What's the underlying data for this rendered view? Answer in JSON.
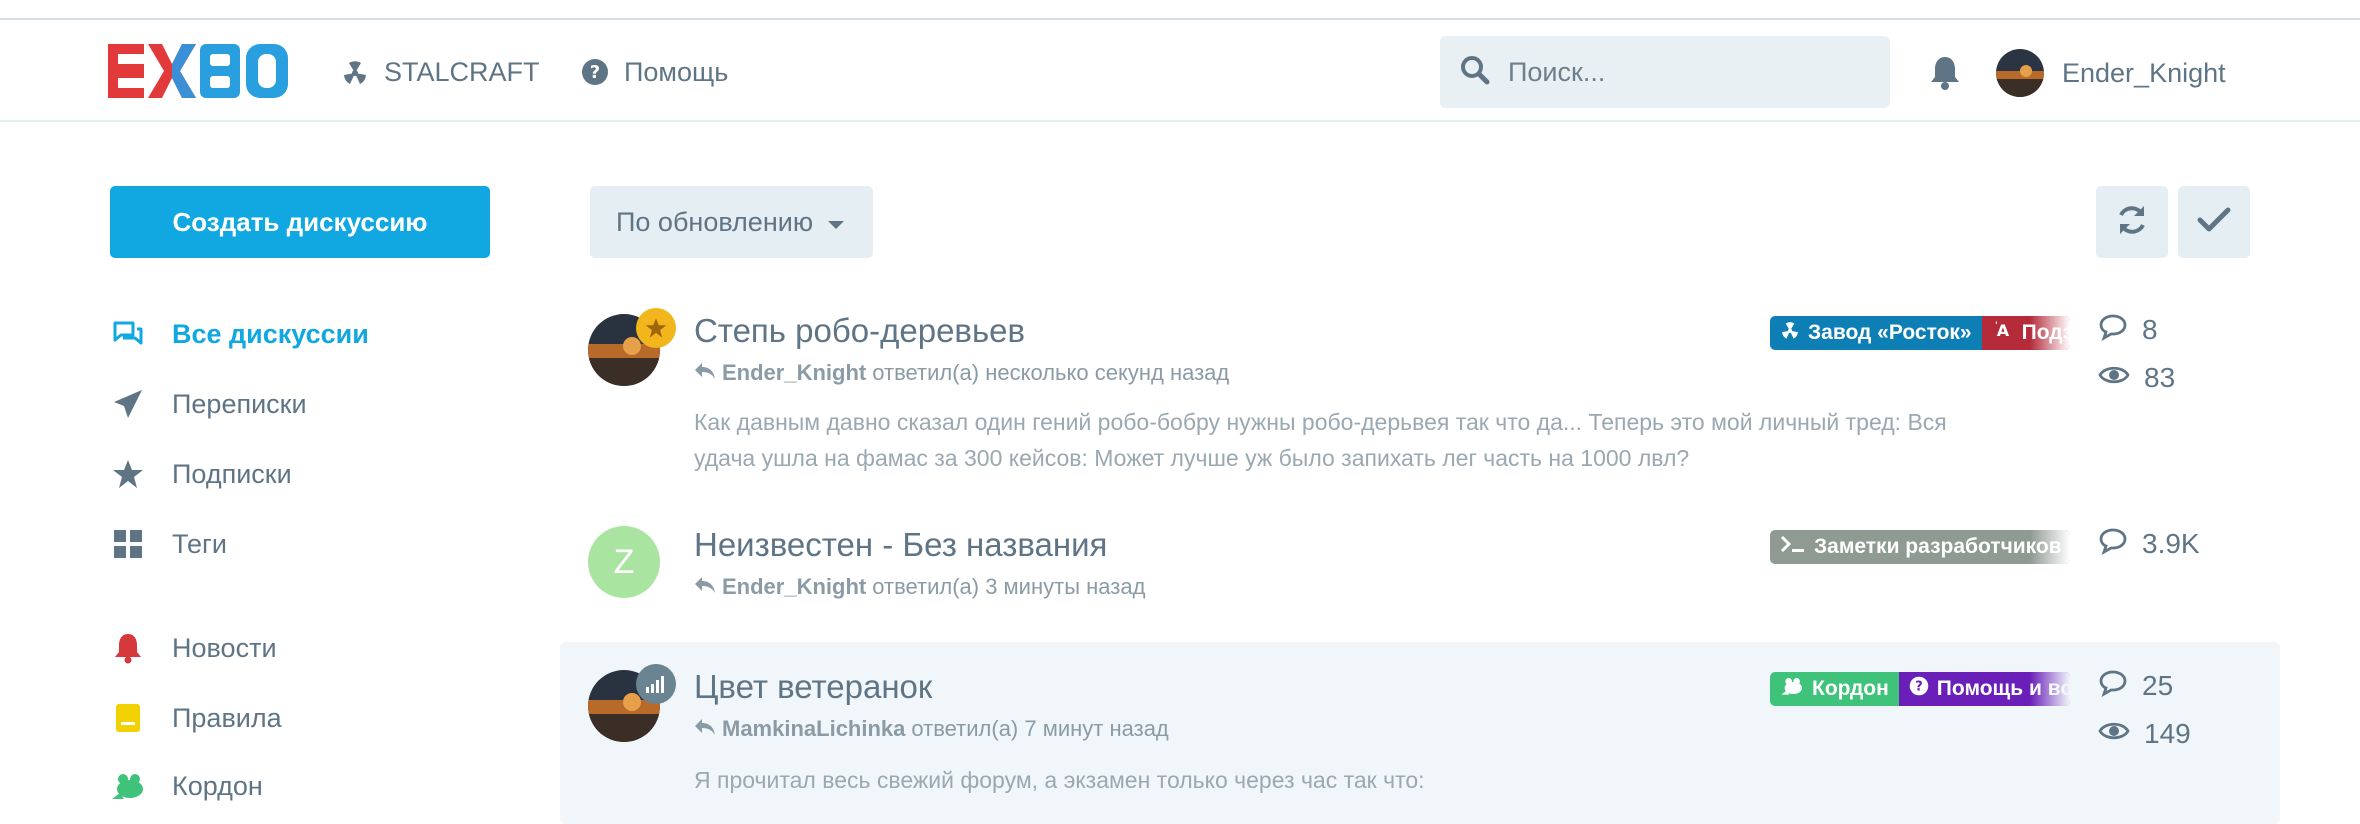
{
  "header": {
    "logo_text": "EXBO",
    "nav": [
      {
        "label": "STALCRAFT",
        "icon": "radiation-icon"
      },
      {
        "label": "Помощь",
        "icon": "question-circle-icon"
      }
    ],
    "search": {
      "placeholder": "Поиск..."
    },
    "user": {
      "name": "Ender_Knight"
    }
  },
  "sidebar": {
    "create_label": "Создать дискуссию",
    "items": [
      {
        "label": "Все дискуссии",
        "icon": "comments-icon",
        "active": true
      },
      {
        "label": "Переписки",
        "icon": "paper-plane-icon"
      },
      {
        "label": "Подписки",
        "icon": "star-icon"
      },
      {
        "label": "Теги",
        "icon": "grid-icon"
      }
    ],
    "links": [
      {
        "label": "Новости",
        "icon": "bell-icon",
        "color": "#d6393b"
      },
      {
        "label": "Правила",
        "icon": "note-icon",
        "color": "#f1d100"
      },
      {
        "label": "Кордон",
        "icon": "frog-icon",
        "color": "#3fc27a"
      }
    ]
  },
  "toolbar": {
    "sort_label": "По обновлению",
    "refresh_icon": "refresh-icon",
    "mark_read_icon": "check-icon"
  },
  "discussions": [
    {
      "title": "Степь робо-деревьев",
      "user": "Ender_Knight",
      "action": "ответил(а) несколько секунд назад",
      "excerpt": "Как давным давно сказал один гений робо-бобру нужны робо-дерьвея так что да... Теперь это мой личный тред: Вся удача ушла на фамас за 300 кейсов: Может лучше уж было запихать лег часть на 1000 лвл?",
      "tags": [
        {
          "label": "Завод «Росток»",
          "color": "#0e7fb5",
          "icon": "radiation-icon"
        },
        {
          "label": "Подземка",
          "color": "#b52b3a",
          "icon": "translate-icon"
        }
      ],
      "replies": "8",
      "views": "83"
    },
    {
      "title": "Неизвестен - Без названия",
      "avatar_letter": "Z",
      "user": "Ender_Knight",
      "action": "ответил(а) 3 минуты назад",
      "tags": [
        {
          "label": "Заметки разработчиков",
          "color": "#8f9a93",
          "icon": "terminal-icon"
        }
      ],
      "replies": "3.9K"
    },
    {
      "title": "Цвет ветеранок",
      "user": "MamkinaLichinka",
      "action": "ответил(а) 7 минут назад",
      "excerpt": "Я прочитал весь свежий форум, а экзамен только через час так что:",
      "tags": [
        {
          "label": "Кордон",
          "color": "#3fc27a",
          "icon": "frog-icon"
        },
        {
          "label": "Помощь и вопросы",
          "color": "#6a1fb8",
          "icon": "question-circle-icon"
        }
      ],
      "replies": "25",
      "views": "149"
    }
  ]
}
